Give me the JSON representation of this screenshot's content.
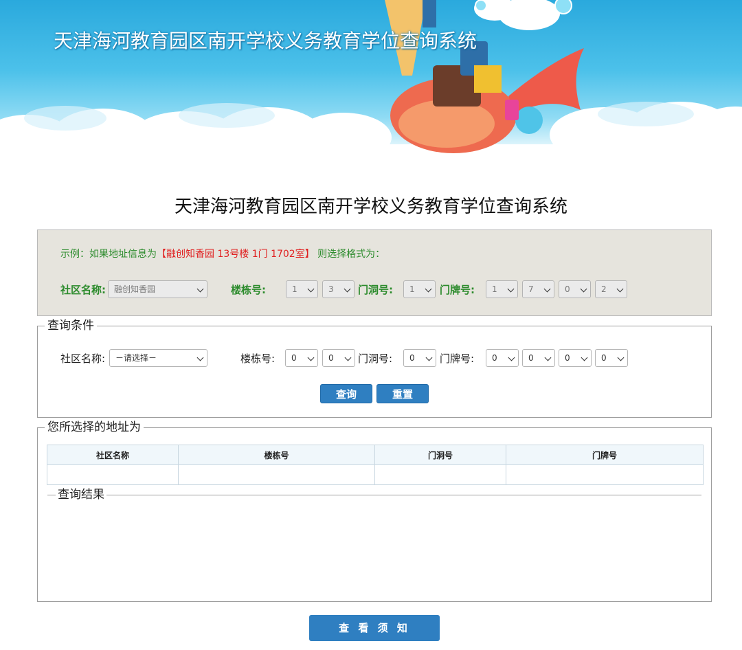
{
  "banner": {
    "title": "天津海河教育园区南开学校义务教育学位查询系统"
  },
  "page": {
    "title": "天津海河教育园区南开学校义务教育学位查询系统"
  },
  "example": {
    "prefix": "示例：如果地址信息为",
    "address": "【融创知香园 13号楼 1门 1702室】",
    "suffix": " 则选择格式为：",
    "community_label": "社区名称:",
    "community_value": "融创知香园",
    "building_label": "楼栋号:",
    "building_values": [
      "1",
      "3"
    ],
    "door_label": "门洞号:",
    "door_value": "1",
    "room_label": "门牌号:",
    "room_values": [
      "1",
      "7",
      "0",
      "2"
    ]
  },
  "query": {
    "legend": "查询条件",
    "community_label": "社区名称:",
    "community_placeholder": "－请选择－",
    "building_label": "楼栋号:",
    "building_values": [
      "0",
      "0"
    ],
    "door_label": "门洞号:",
    "door_value": "0",
    "room_label": "门牌号:",
    "room_values": [
      "0",
      "0",
      "0",
      "0"
    ],
    "search_button": "查询",
    "reset_button": "重置"
  },
  "selected": {
    "legend": "您所选择的地址为",
    "columns": [
      "社区名称",
      "楼栋号",
      "门洞号",
      "门牌号"
    ],
    "result_legend": "查询结果"
  },
  "footer": {
    "notice_button": "查 看 须 知"
  },
  "colors": {
    "accent_blue": "#2f7fc1",
    "example_green": "#2c8b2c",
    "example_red": "#e02020",
    "panel_bg": "#e6e4dd"
  }
}
